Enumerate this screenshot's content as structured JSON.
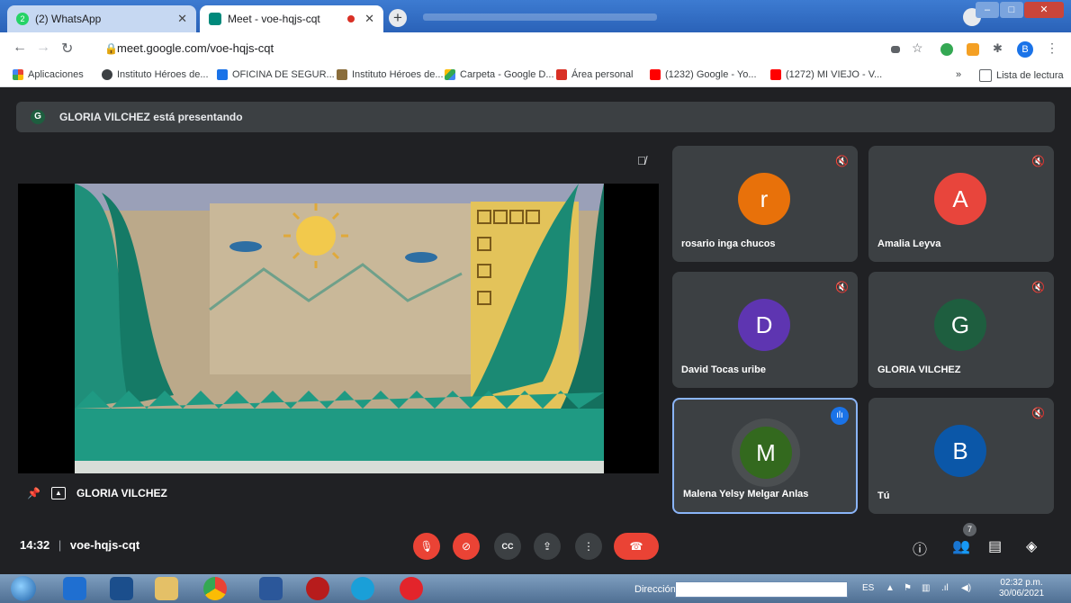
{
  "browser": {
    "tabs": [
      {
        "label": "(2) WhatsApp",
        "badge": "2"
      },
      {
        "label": "Meet - voe-hqjs-cqt"
      }
    ],
    "url": "meet.google.com/voe-hqjs-cqt",
    "profile_initial": "B",
    "bookmarks": [
      "Aplicaciones",
      "Instituto Héroes de...",
      "OFICINA DE SEGUR...",
      "Instituto Héroes de...",
      "Carpeta - Google D...",
      "Área personal",
      "(1232) Google - Yo...",
      "(1272) MI VIEJO - V..."
    ],
    "bookmarks_more": "»",
    "reading_list": "Lista de lectura"
  },
  "meet": {
    "banner_initial": "G",
    "banner_text": "GLORIA VILCHEZ está presentando",
    "presenter_name": "GLORIA VILCHEZ",
    "participants": [
      {
        "name": "rosario inga chucos",
        "initial": "r",
        "color": "#e8710a"
      },
      {
        "name": "Amalia Leyva",
        "initial": "A",
        "color": "#e8453c"
      },
      {
        "name": "David Tocas uribe",
        "initial": "D",
        "color": "#5e35b1"
      },
      {
        "name": "GLORIA VILCHEZ",
        "initial": "G",
        "color": "#1e5e3f"
      },
      {
        "name": "Malena Yelsy Melgar Anlas",
        "initial": "M",
        "color": "#33691e"
      },
      {
        "name": "Tú",
        "initial": "B",
        "color": "#0b57a8"
      }
    ],
    "time": "14:32",
    "meeting_code": "voe-hqjs-cqt",
    "participant_count": "7"
  },
  "taskbar": {
    "address_label": "Dirección",
    "language": "ES",
    "time": "02:32 p.m.",
    "date": "30/06/2021"
  }
}
